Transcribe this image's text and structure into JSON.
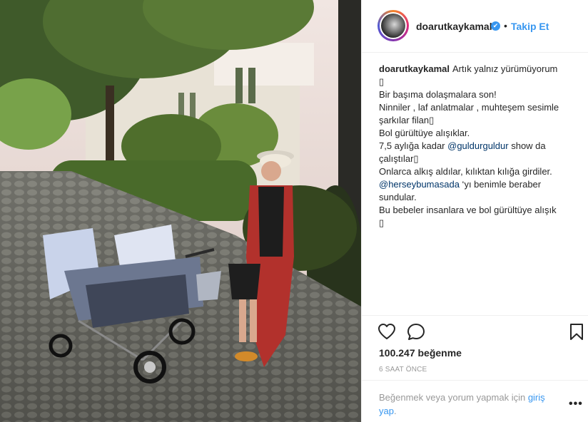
{
  "header": {
    "username": "doarutkaykamal",
    "verified_symbol": "✔",
    "separator": "•",
    "follow_label": "Takip Et"
  },
  "caption": {
    "author": "doarutkaykamal",
    "first_text": "Artık yalnız yürümüyorum",
    "box_char": "▯",
    "line2": "Bir başıma dolaşmalara son!",
    "line3": "Ninniler , laf anlatmalar , muhteşem sesimle",
    "line4": "şarkılar filan▯",
    "line5": "Bol gürültüye alışıklar.",
    "line6_before": "7,5 aylığa kadar ",
    "line6_mention": "@guldurguldur",
    "line6_after": " show da",
    "line7": "çalıştılar▯",
    "line8": "Onlarca alkış aldılar, kılıktan kılığa girdiler.",
    "line9_mention": "@herseybumasada",
    "line9_after": " ‘yı benimle beraber",
    "line10": "sundular.",
    "line11": "Bu bebeler insanlara ve bol gürültüye alışık"
  },
  "actions": {
    "like_icon": "heart-icon",
    "comment_icon": "comment-icon",
    "save_icon": "bookmark-icon"
  },
  "stats": {
    "likes": "100.247 beğenme",
    "time": "6 SAAT ÖNCE"
  },
  "footer": {
    "login_prompt": "Beğenmek veya yorum yapmak için ",
    "login_link": "giriş yap",
    "login_suffix": ".",
    "more": "•••"
  },
  "colors": {
    "accent": "#3897f0",
    "text": "#262626",
    "muted": "#999999"
  }
}
